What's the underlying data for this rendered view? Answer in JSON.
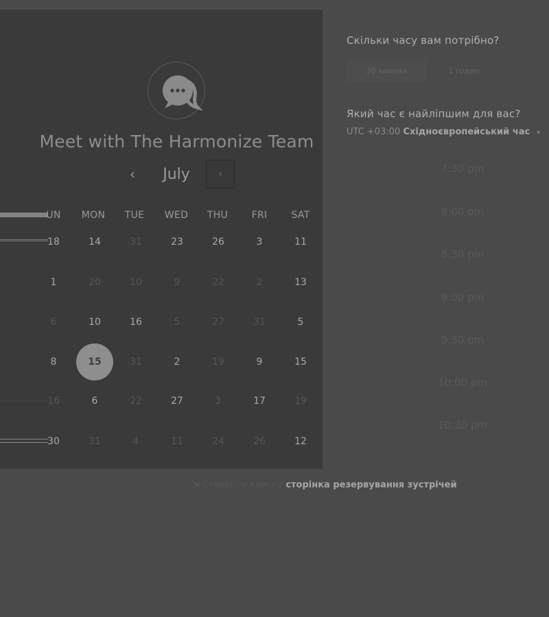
{
  "header": {
    "title": "Meet with The Harmonize Team",
    "logo_icon": "chat-bubble-icon"
  },
  "calendar": {
    "month": "July",
    "prev_icon": "‹",
    "next_icon": "›",
    "weekdays": [
      "UN",
      "MON",
      "TUE",
      "WED",
      "THU",
      "FRI",
      "SAT"
    ],
    "weeks": [
      [
        {
          "d": "18",
          "a": true
        },
        {
          "d": "14",
          "a": true
        },
        {
          "d": "31",
          "a": false
        },
        {
          "d": "23",
          "a": true
        },
        {
          "d": "26",
          "a": true
        },
        {
          "d": "3",
          "a": true
        },
        {
          "d": "11",
          "a": true
        }
      ],
      [
        {
          "d": "1",
          "a": true
        },
        {
          "d": "20",
          "a": false
        },
        {
          "d": "10",
          "a": false
        },
        {
          "d": "9",
          "a": false
        },
        {
          "d": "22",
          "a": false
        },
        {
          "d": "2",
          "a": false
        },
        {
          "d": "13",
          "a": true
        }
      ],
      [
        {
          "d": "6",
          "a": false
        },
        {
          "d": "10",
          "a": true
        },
        {
          "d": "16",
          "a": true
        },
        {
          "d": "5",
          "a": false
        },
        {
          "d": "27",
          "a": false
        },
        {
          "d": "31",
          "a": false
        },
        {
          "d": "5",
          "a": true
        }
      ],
      [
        {
          "d": "8",
          "a": true
        },
        {
          "d": "15",
          "a": true,
          "selected": true
        },
        {
          "d": "31",
          "a": false
        },
        {
          "d": "2",
          "a": true
        },
        {
          "d": "19",
          "a": false
        },
        {
          "d": "9",
          "a": true
        },
        {
          "d": "15",
          "a": true
        }
      ],
      [
        {
          "d": "16",
          "a": false
        },
        {
          "d": "6",
          "a": true
        },
        {
          "d": "22",
          "a": false
        },
        {
          "d": "27",
          "a": true
        },
        {
          "d": "3",
          "a": false
        },
        {
          "d": "17",
          "a": true
        },
        {
          "d": "19",
          "a": false
        }
      ],
      [
        {
          "d": "30",
          "a": true
        },
        {
          "d": "31",
          "a": false
        },
        {
          "d": "4",
          "a": false
        },
        {
          "d": "11",
          "a": false
        },
        {
          "d": "24",
          "a": false
        },
        {
          "d": "26",
          "a": false
        },
        {
          "d": "12",
          "a": true
        }
      ]
    ]
  },
  "duration": {
    "question": "Скільки часу вам потрібно?",
    "options": [
      "30 хвилин",
      "1 годин"
    ]
  },
  "time": {
    "question": "Який час є найліпшим для вас?",
    "tz_offset": "UTC +03:00",
    "tz_name": "Східноєвропейський час",
    "tz_caret": "▾",
    "slots": [
      "7:30 pm",
      "8:00 pm",
      "8:30 pm",
      "9:00 pm",
      "9:30 pm",
      "10:00 pm",
      "10:30 pm"
    ]
  },
  "footer": {
    "icon": "⇲",
    "text1": "Створити власну",
    "text2": "сторінка резервування зустрічей"
  },
  "colors": {
    "background": "#4a4a4a",
    "panel": "#3a3a3a",
    "selected_day": "#8e8e8e"
  }
}
